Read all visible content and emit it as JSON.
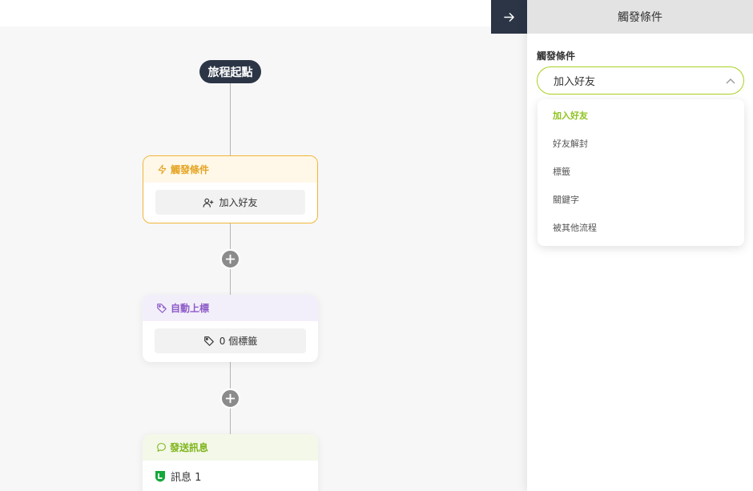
{
  "flow": {
    "start_label": "旅程起點",
    "trigger_node": {
      "title": "觸發條件",
      "value": "加入好友"
    },
    "tag_node": {
      "title": "自動上標",
      "value": "0 個標籤"
    },
    "message_node": {
      "title": "發送訊息",
      "message": "訊息 1"
    }
  },
  "panel": {
    "title": "觸發條件",
    "field_label": "觸發條件",
    "selected_value": "加入好友",
    "options": [
      "加入好友",
      "好友解封",
      "標籤",
      "關鍵字",
      "被其他流程"
    ]
  },
  "colors": {
    "dark": "#2b3546",
    "trigger_accent": "#e5a423",
    "tag_accent": "#8d5bc8",
    "message_accent": "#7fb51c",
    "select_accent": "#a8d020"
  },
  "icons": {
    "collapse": "arrow-right-icon",
    "trigger": "lightning-icon",
    "add_friend": "user-plus-icon",
    "tag": "tag-icon",
    "message": "chat-bubble-icon",
    "line": "line-badge-icon",
    "chevron": "chevron-up-icon",
    "add": "plus-icon"
  }
}
